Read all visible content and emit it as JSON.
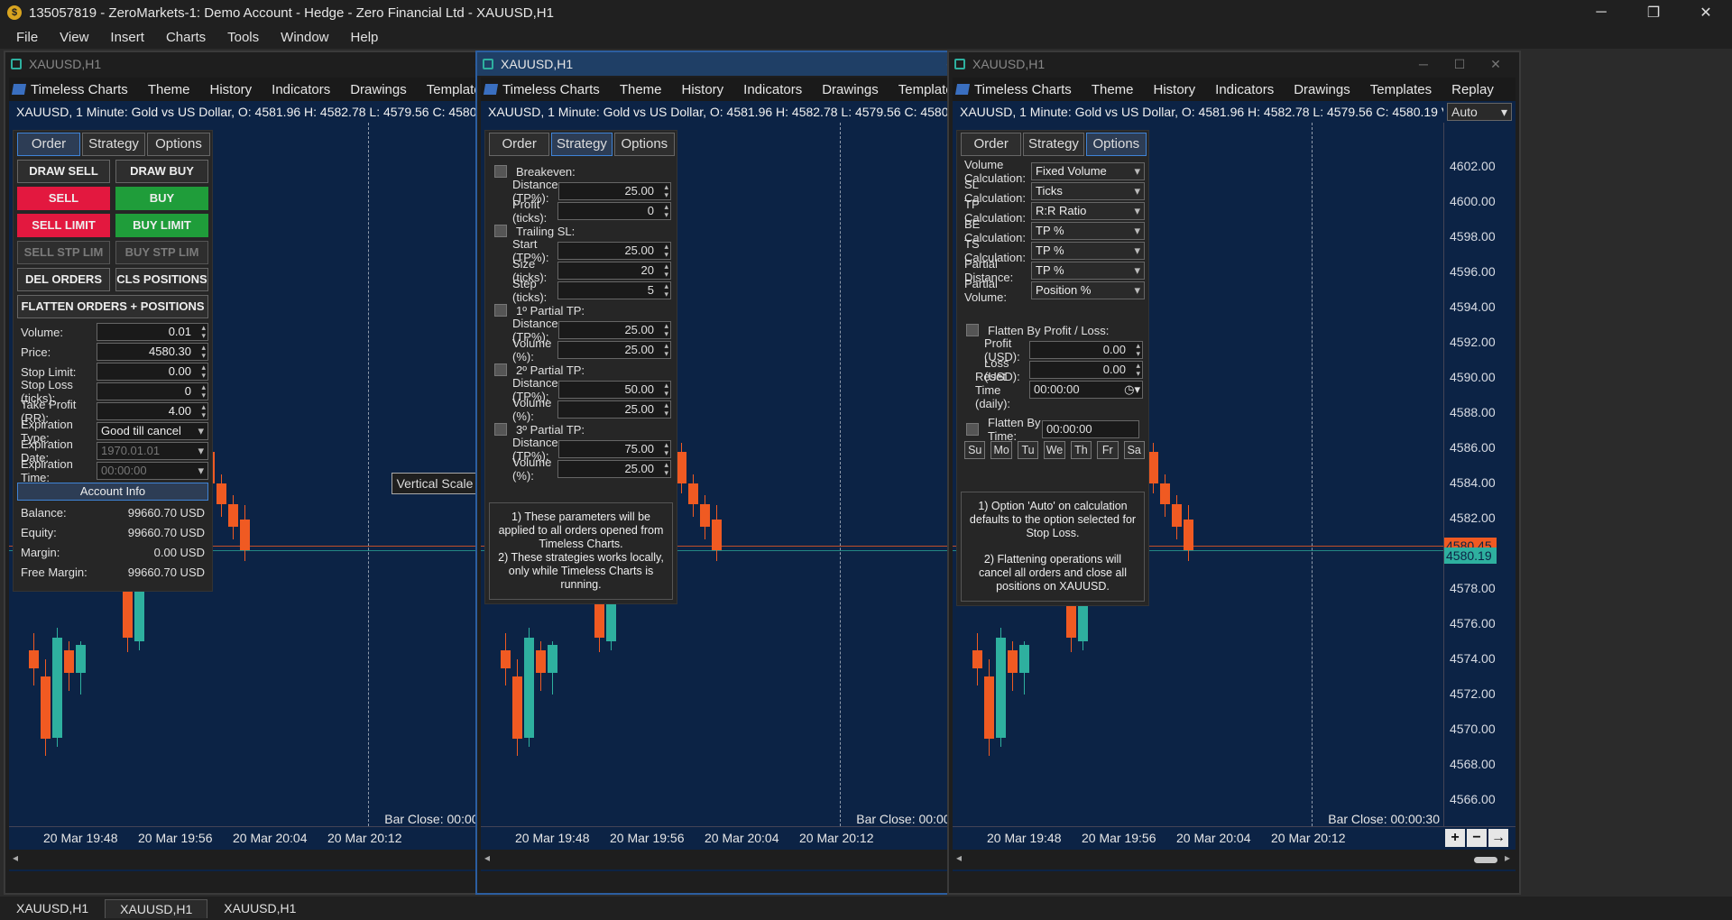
{
  "app": {
    "title": "135057819 - ZeroMarkets-1: Demo Account - Hedge - Zero Financial Ltd - XAUUSD,H1"
  },
  "menu": [
    "File",
    "View",
    "Insert",
    "Charts",
    "Tools",
    "Window",
    "Help"
  ],
  "windows": [
    {
      "title": "XAUUSD,H1",
      "active": false,
      "panel": "order"
    },
    {
      "title": "XAUUSD,H1",
      "active": true,
      "panel": "strategy"
    },
    {
      "title": "XAUUSD,H1",
      "active": false,
      "panel": "options"
    }
  ],
  "toolbar": [
    "Timeless Charts",
    "Theme",
    "History",
    "Indicators",
    "Drawings",
    "Templates",
    "Replay"
  ],
  "chart": {
    "info": "XAUUSD, 1 Minute: Gold vs US Dollar, O: 4581.96 H: 4582.78 L: 4579.56 C: 4580.19 V",
    "mode": "Auto",
    "yticks": [
      "4602.00",
      "4600.00",
      "4598.00",
      "4596.00",
      "4594.00",
      "4592.00",
      "4590.00",
      "4588.00",
      "4586.00",
      "4584.00",
      "4582.00",
      "4580.00",
      "4578.00",
      "4576.00",
      "4574.00",
      "4572.00",
      "4570.00",
      "4568.00",
      "4566.00"
    ],
    "price_tag": "4580.19",
    "price_tag_hidden": "4580.45",
    "xticks": [
      "20 Mar 19:48",
      "20 Mar 19:56",
      "20 Mar 20:04",
      "20 Mar 20:12"
    ],
    "bar_close": "Bar Close: 00:00:30",
    "zoom": [
      "+",
      "−",
      "→"
    ],
    "tooltip": "Vertical Scale",
    "colors": {
      "bull": "#2eb09f",
      "bear": "#f05a22",
      "bg": "#0c2345"
    }
  },
  "tabs": [
    "Order",
    "Strategy",
    "Options"
  ],
  "order": {
    "draw_sell": "DRAW SELL",
    "draw_buy": "DRAW BUY",
    "sell": "SELL",
    "buy": "BUY",
    "sell_limit": "SELL LIMIT",
    "buy_limit": "BUY LIMIT",
    "sell_stp": "SELL STP LIM",
    "buy_stp": "BUY STP LIM",
    "del_orders": "DEL ORDERS",
    "cls_positions": "CLS POSITIONS",
    "flatten": "FLATTEN ORDERS + POSITIONS",
    "fields": [
      {
        "label": "Volume:",
        "value": "0.01"
      },
      {
        "label": "Price:",
        "value": "4580.30"
      },
      {
        "label": "Stop Limit:",
        "value": "0.00"
      },
      {
        "label": "Stop Loss (ticks):",
        "value": "0"
      },
      {
        "label": "Take Profit (RR):",
        "value": "4.00"
      }
    ],
    "exp_type_label": "Expiration Type:",
    "exp_type": "Good till cancel",
    "exp_date_label": "Expiration Date:",
    "exp_date": "1970.01.01",
    "exp_time_label": "Expiration Time:",
    "exp_time": "00:00:00",
    "account_info": "Account Info",
    "account": [
      {
        "label": "Balance:",
        "value": "99660.70 USD"
      },
      {
        "label": "Equity:",
        "value": "99660.70 USD"
      },
      {
        "label": "Margin:",
        "value": "0.00 USD"
      },
      {
        "label": "Free Margin:",
        "value": "99660.70 USD"
      }
    ]
  },
  "strategy": {
    "breakeven": "Breakeven:",
    "be_distance": "Distance (TP%):",
    "be_distance_v": "25.00",
    "be_profit": "Profit (ticks):",
    "be_profit_v": "0",
    "trailing": "Trailing SL:",
    "ts_start": "Start (TP%):",
    "ts_start_v": "25.00",
    "ts_size": "Size (ticks):",
    "ts_size_v": "20",
    "ts_step": "Step (ticks):",
    "ts_step_v": "5",
    "p1": "1º Partial TP:",
    "p1_dist": "Distance (TP%):",
    "p1_dist_v": "25.00",
    "p1_vol": "Volume (%):",
    "p1_vol_v": "25.00",
    "p2": "2º Partial TP:",
    "p2_dist": "Distance (TP%):",
    "p2_dist_v": "50.00",
    "p2_vol": "Volume (%):",
    "p2_vol_v": "25.00",
    "p3": "3º Partial TP:",
    "p3_dist": "Distance (TP%):",
    "p3_dist_v": "75.00",
    "p3_vol": "Volume (%):",
    "p3_vol_v": "25.00",
    "note1": "1) These parameters will be applied to all orders opened from Timeless Charts.",
    "note2": "2) These strategies works locally, only while Timeless Charts is running."
  },
  "options": {
    "rows": [
      {
        "label": "Volume Calculation:",
        "value": "Fixed Volume"
      },
      {
        "label": "SL Calculation:",
        "value": "Ticks"
      },
      {
        "label": "TP Calculation:",
        "value": "R:R Ratio"
      },
      {
        "label": "BE Calculation:",
        "value": "TP %"
      },
      {
        "label": "TS Calculation:",
        "value": "TP %"
      },
      {
        "label": "Partial Distance:",
        "value": "TP %"
      },
      {
        "label": "Partial Volume:",
        "value": "Position %"
      }
    ],
    "flatten_pl": "Flatten By Profit / Loss:",
    "profit_label": "Profit (USD):",
    "profit": "0.00",
    "loss_label": "Loss (USD):",
    "loss": "0.00",
    "reset_label": "Reset Time (daily):",
    "reset": "00:00:00",
    "flatten_time": "Flatten By Time:",
    "flatten_time_v": "00:00:00",
    "days": [
      "Su",
      "Mo",
      "Tu",
      "We",
      "Th",
      "Fr",
      "Sa"
    ],
    "note1": "1) Option 'Auto' on calculation defaults to the option selected for Stop Loss.",
    "note2": "2) Flattening operations will cancel all orders and close all positions on XAUUSD."
  },
  "bottom_tabs": [
    "XAUUSD,H1",
    "XAUUSD,H1",
    "XAUUSD,H1"
  ]
}
